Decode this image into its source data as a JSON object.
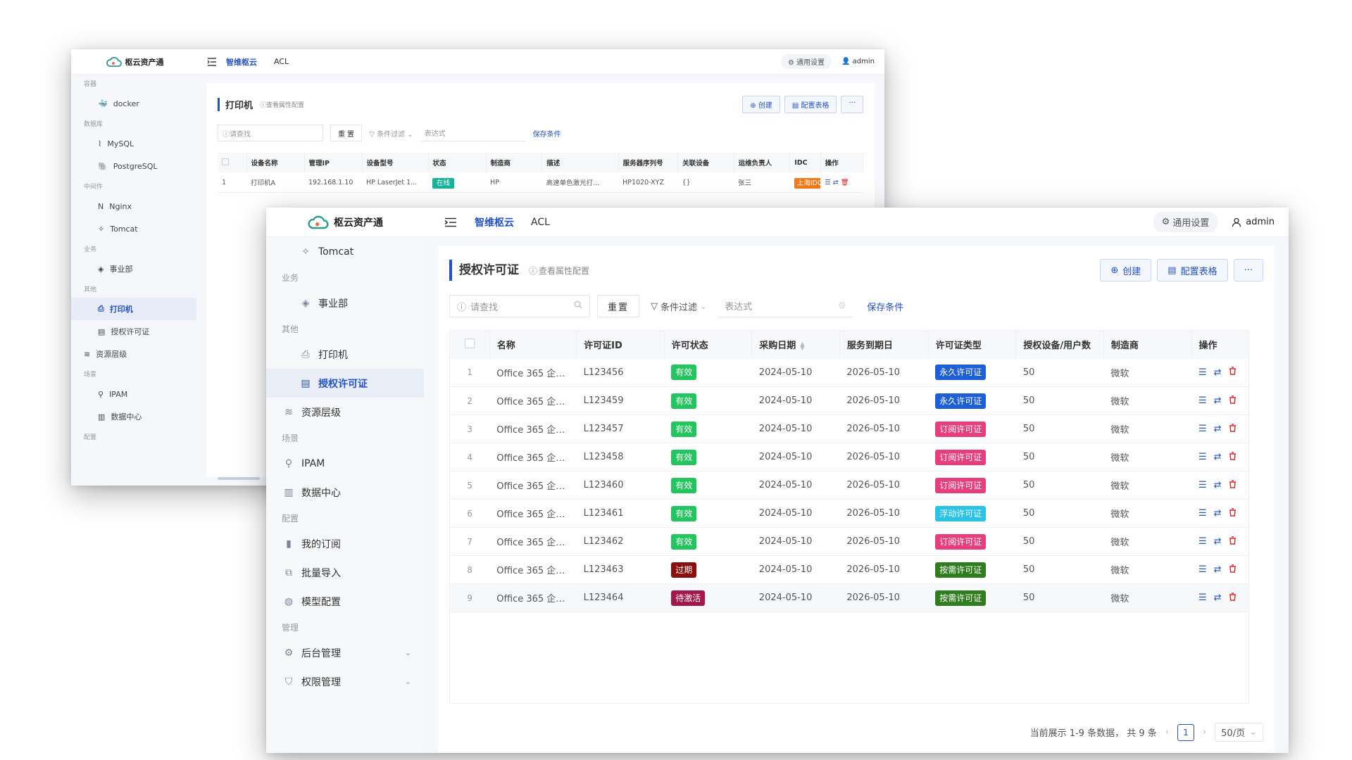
{
  "app": {
    "logo_text": "枢云资产通",
    "nav": [
      "智维枢云",
      "ACL"
    ],
    "settings_label": "通用设置",
    "user": "admin"
  },
  "back": {
    "sidebar": [
      {
        "kind": "group",
        "label": "容器"
      },
      {
        "kind": "item",
        "label": "docker",
        "icon": "docker-icon"
      },
      {
        "kind": "group",
        "label": "数据库"
      },
      {
        "kind": "item",
        "label": "MySQL",
        "icon": "mysql-icon"
      },
      {
        "kind": "item",
        "label": "PostgreSQL",
        "icon": "postgresql-icon"
      },
      {
        "kind": "group",
        "label": "中间件"
      },
      {
        "kind": "item",
        "label": "Nginx",
        "icon": "nginx-icon"
      },
      {
        "kind": "item",
        "label": "Tomcat",
        "icon": "tomcat-icon"
      },
      {
        "kind": "group",
        "label": "业务"
      },
      {
        "kind": "item",
        "label": "事业部",
        "icon": "layers-icon"
      },
      {
        "kind": "group",
        "label": "其他"
      },
      {
        "kind": "item",
        "label": "打印机",
        "icon": "printer-icon",
        "active": true
      },
      {
        "kind": "item",
        "label": "授权许可证",
        "icon": "document-icon"
      },
      {
        "kind": "l1",
        "label": "资源层级",
        "icon": "stack-icon"
      },
      {
        "kind": "group",
        "label": "场景"
      },
      {
        "kind": "item",
        "label": "IPAM",
        "icon": "pin-icon"
      },
      {
        "kind": "item",
        "label": "数据中心",
        "icon": "building-icon"
      },
      {
        "kind": "group",
        "label": "配置"
      }
    ],
    "title": "打印机",
    "subtitle": "查看属性配置",
    "create_label": "创建",
    "config_label": "配置表格",
    "more_label": "···",
    "search_placeholder": "请查找",
    "reset_label": "重 置",
    "filter_label": "条件过滤",
    "expr_placeholder": "表达式",
    "save_label": "保存条件",
    "columns": [
      "设备名称",
      "管理IP",
      "设备型号",
      "状态",
      "制造商",
      "描述",
      "服务器序列号",
      "关联设备",
      "运维负责人",
      "IDC",
      "操作"
    ],
    "row": {
      "index": "1",
      "name": "打印机A",
      "ip": "192.168.1.10",
      "model": "HP LaserJet 1...",
      "status": "在线",
      "maker": "HP",
      "desc": "高速单色激光打...",
      "serial": "HP1020-XYZ",
      "related": "{}",
      "owner": "张三",
      "idc": "上海IDC"
    }
  },
  "front": {
    "sidebar": [
      {
        "kind": "item",
        "label": "Tomcat",
        "icon": "tomcat-icon"
      },
      {
        "kind": "group",
        "label": "业务"
      },
      {
        "kind": "item",
        "label": "事业部",
        "icon": "layers-icon"
      },
      {
        "kind": "group",
        "label": "其他"
      },
      {
        "kind": "item",
        "label": "打印机",
        "icon": "printer-icon"
      },
      {
        "kind": "item",
        "label": "授权许可证",
        "icon": "document-icon",
        "active": true
      },
      {
        "kind": "l1",
        "label": "资源层级",
        "icon": "stack-icon"
      },
      {
        "kind": "group",
        "label": "场景"
      },
      {
        "kind": "l1",
        "label": "IPAM",
        "icon": "pin-icon"
      },
      {
        "kind": "l1",
        "label": "数据中心",
        "icon": "building-icon"
      },
      {
        "kind": "group",
        "label": "配置"
      },
      {
        "kind": "l1",
        "label": "我的订阅",
        "icon": "bookmark-icon"
      },
      {
        "kind": "l1",
        "label": "批量导入",
        "icon": "import-icon"
      },
      {
        "kind": "l1",
        "label": "模型配置",
        "icon": "model-icon"
      },
      {
        "kind": "group",
        "label": "管理"
      },
      {
        "kind": "l1",
        "label": "后台管理",
        "icon": "gear-icon",
        "caret": true
      },
      {
        "kind": "l1",
        "label": "权限管理",
        "icon": "shield-icon",
        "caret": true
      }
    ],
    "title": "授权许可证",
    "subtitle": "查看属性配置",
    "create_label": "创建",
    "config_label": "配置表格",
    "more_label": "···",
    "search_placeholder": "请查找",
    "reset_label": "重置",
    "filter_label": "条件过滤",
    "expr_placeholder": "表达式",
    "save_label": "保存条件",
    "columns": [
      "名称",
      "许可证ID",
      "许可状态",
      "采购日期",
      "服务到期日",
      "许可证类型",
      "授权设备/用户数",
      "制造商",
      "操作"
    ],
    "rows": [
      {
        "index": "1",
        "name": "Office 365 企业...",
        "id": "L123456",
        "status": "有效",
        "status_color": "#22c55e",
        "buy": "2024-05-10",
        "expire": "2026-05-10",
        "type": "永久许可证",
        "type_color": "#1d5fd8",
        "count": "50",
        "maker": "微软"
      },
      {
        "index": "2",
        "name": "Office 365 企业...",
        "id": "L123459",
        "status": "有效",
        "status_color": "#22c55e",
        "buy": "2024-05-10",
        "expire": "2026-05-10",
        "type": "永久许可证",
        "type_color": "#1d5fd8",
        "count": "50",
        "maker": "微软"
      },
      {
        "index": "3",
        "name": "Office 365 企业...",
        "id": "L123457",
        "status": "有效",
        "status_color": "#22c55e",
        "buy": "2024-05-10",
        "expire": "2026-05-10",
        "type": "订阅许可证",
        "type_color": "#e83e7c",
        "count": "50",
        "maker": "微软"
      },
      {
        "index": "4",
        "name": "Office 365 企业...",
        "id": "L123458",
        "status": "有效",
        "status_color": "#22c55e",
        "buy": "2024-05-10",
        "expire": "2026-05-10",
        "type": "订阅许可证",
        "type_color": "#e83e7c",
        "count": "50",
        "maker": "微软"
      },
      {
        "index": "5",
        "name": "Office 365 企业...",
        "id": "L123460",
        "status": "有效",
        "status_color": "#22c55e",
        "buy": "2024-05-10",
        "expire": "2026-05-10",
        "type": "订阅许可证",
        "type_color": "#e83e7c",
        "count": "50",
        "maker": "微软"
      },
      {
        "index": "6",
        "name": "Office 365 企业...",
        "id": "L123461",
        "status": "有效",
        "status_color": "#22c55e",
        "buy": "2024-05-10",
        "expire": "2026-05-10",
        "type": "浮动许可证",
        "type_color": "#27c3e8",
        "count": "50",
        "maker": "微软"
      },
      {
        "index": "7",
        "name": "Office 365 企业...",
        "id": "L123462",
        "status": "有效",
        "status_color": "#22c55e",
        "buy": "2024-05-10",
        "expire": "2026-05-10",
        "type": "订阅许可证",
        "type_color": "#e83e7c",
        "count": "50",
        "maker": "微软"
      },
      {
        "index": "8",
        "name": "Office 365 企业...",
        "id": "L123463",
        "status": "过期",
        "status_color": "#8b0d0d",
        "buy": "2024-05-10",
        "expire": "2026-05-10",
        "type": "按需许可证",
        "type_color": "#2f7d1e",
        "count": "50",
        "maker": "微软"
      },
      {
        "index": "9",
        "name": "Office 365 企业...",
        "id": "L123464",
        "status": "待激活",
        "status_color": "#a3174a",
        "buy": "2024-05-10",
        "expire": "2026-05-10",
        "type": "按需许可证",
        "type_color": "#2f7d1e",
        "count": "50",
        "maker": "微软"
      }
    ],
    "pager": {
      "summary": "当前展示 1-9 条数据，  共 9 条",
      "page": "1",
      "page_size": "50/页"
    }
  }
}
